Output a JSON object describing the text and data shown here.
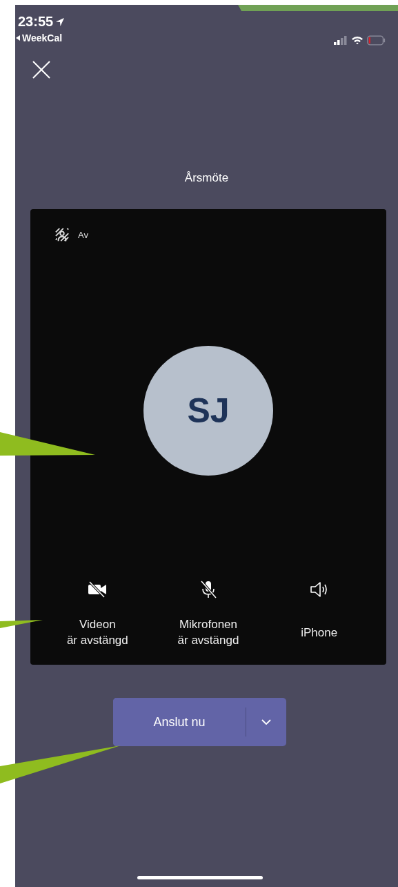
{
  "status_bar": {
    "time": "23:55",
    "back_app": "WeekCal"
  },
  "title": "Årsmöte",
  "background_effect": {
    "label": "Av"
  },
  "avatar": {
    "initials": "SJ"
  },
  "controls": [
    {
      "kind": "video",
      "label": "Videon\när avstängd",
      "off": true
    },
    {
      "kind": "microphone",
      "label": "Mikrofonen\när avstängd",
      "off": true
    },
    {
      "kind": "speaker",
      "label": "iPhone",
      "off": false
    }
  ],
  "join_button": {
    "label": "Anslut nu"
  }
}
